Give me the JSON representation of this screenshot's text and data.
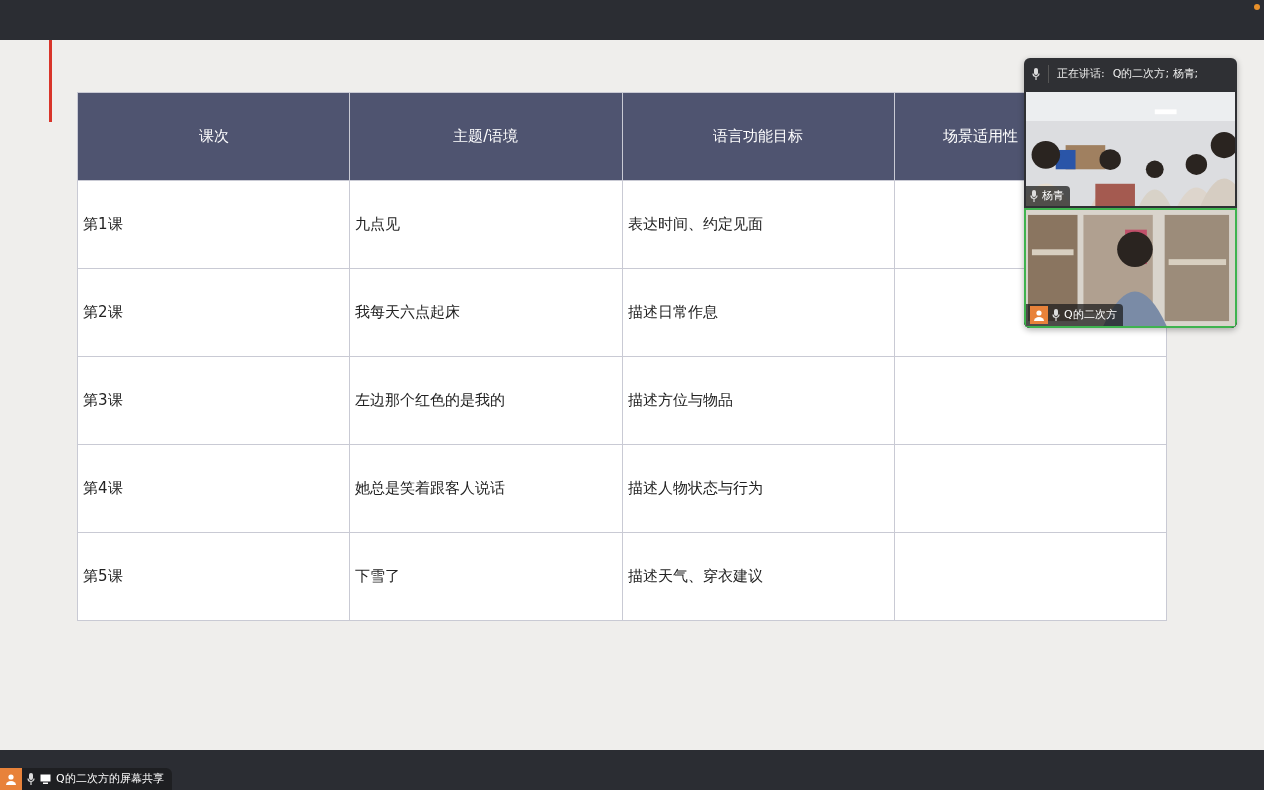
{
  "slide": {
    "table": {
      "columns": [
        "课次",
        "主题/语境",
        "语言功能目标",
        "场景适用性"
      ],
      "rows": [
        {
          "lesson": "第1课",
          "topic": "九点见",
          "goal": "表达时间、约定见面"
        },
        {
          "lesson": "第2课",
          "topic": "我每天六点起床",
          "goal": "描述日常作息"
        },
        {
          "lesson": "第3课",
          "topic": "左边那个红色的是我的",
          "goal": "描述方位与物品"
        },
        {
          "lesson": "第4课",
          "topic": "她总是笑着跟客人说话",
          "goal": "描述人物状态与行为"
        },
        {
          "lesson": "第5课",
          "topic": "下雪了",
          "goal": "描述天气、穿衣建议"
        }
      ]
    }
  },
  "video_panel": {
    "speaking_label": "正在讲话:",
    "speakers": "Q的二次方; 杨青;",
    "tiles": [
      {
        "name": "杨青",
        "kind": "group",
        "active": false
      },
      {
        "name": "Q的二次方",
        "kind": "single",
        "active": true
      }
    ]
  },
  "share_status": {
    "label": "Q的二次方的屏幕共享"
  }
}
